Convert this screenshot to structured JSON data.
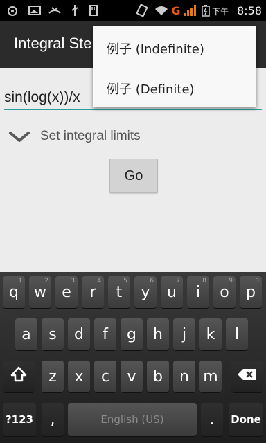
{
  "status_bar": {
    "ime_label": "下午",
    "time": "8:58",
    "carrier_badge": "G",
    "icons": [
      "notification-icon",
      "gallery-icon",
      "missed-call-icon",
      "usb-icon",
      "sd-card-icon",
      "rotation-icon",
      "wifi-icon",
      "signal-icon",
      "battery-icon"
    ]
  },
  "app": {
    "title": "Integral Ste"
  },
  "input": {
    "value": "sin(log(x))/x"
  },
  "limits": {
    "label": "Set integral limits"
  },
  "go": {
    "label": "Go"
  },
  "menu": {
    "items": [
      "例子 (Indefinite)",
      "例子 (Definite)"
    ]
  },
  "keyboard": {
    "row1": [
      [
        "q",
        "1"
      ],
      [
        "w",
        "2"
      ],
      [
        "e",
        "3"
      ],
      [
        "r",
        "4"
      ],
      [
        "t",
        "5"
      ],
      [
        "y",
        "6"
      ],
      [
        "u",
        "7"
      ],
      [
        "i",
        "8"
      ],
      [
        "o",
        "9"
      ],
      [
        "p",
        "0"
      ]
    ],
    "row2": [
      "a",
      "s",
      "d",
      "f",
      "g",
      "h",
      "j",
      "k",
      "l"
    ],
    "row3": [
      "z",
      "x",
      "c",
      "v",
      "b",
      "n",
      "m"
    ],
    "mode_key": "?123",
    "comma_key": ",",
    "space_label": "English (US)",
    "period_key": ".",
    "done_key": "Done",
    "accent_color": "#2a9d9a"
  }
}
